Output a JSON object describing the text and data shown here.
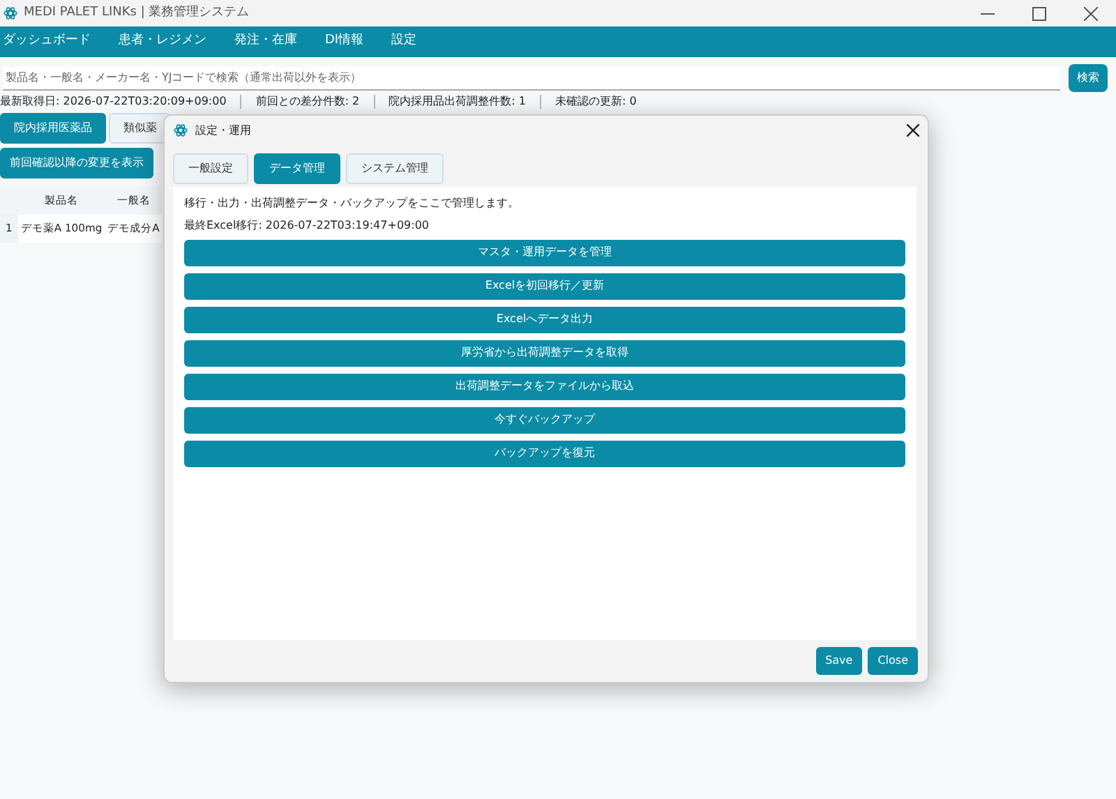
{
  "window": {
    "title": "MEDI PALET LINKs | 業務管理システム"
  },
  "menu": [
    {
      "label": "ダッシュボード"
    },
    {
      "label": "患者・レジメン"
    },
    {
      "label": "発注・在庫"
    },
    {
      "label": "DI情報"
    },
    {
      "label": "設定"
    }
  ],
  "search": {
    "placeholder": "製品名・一般名・メーカー名・YJコードで検索（通常出荷以外を表示）",
    "button": "検索"
  },
  "status": [
    "最新取得日: 2026-07-22T03:20:09+09:00",
    "前回との差分件数: 2",
    "院内採用品出荷調整件数: 1",
    "未確認の更新: 0"
  ],
  "filters": [
    {
      "label": "院内採用医薬品"
    },
    {
      "label": "類似薬"
    }
  ],
  "changes_button": "前回確認以降の変更を表示",
  "table": {
    "columns": [
      "製品名",
      "一般名"
    ],
    "rows": [
      {
        "number": "1",
        "cells": [
          "デモ薬A 100mg",
          "デモ成分A"
        ]
      }
    ]
  },
  "dialog": {
    "title": "設定・運用",
    "tabs": [
      {
        "label": "一般設定",
        "selected": false
      },
      {
        "label": "データ管理",
        "selected": true
      },
      {
        "label": "システム管理",
        "selected": false
      }
    ],
    "description": "移行・出力・出荷調整データ・バックアップをここで管理します。",
    "last_migration": "最終Excel移行: 2026-07-22T03:19:47+09:00",
    "actions": [
      "マスタ・運用データを管理",
      "Excelを初回移行／更新",
      "Excelへデータ出力",
      "厚労省から出荷調整データを取得",
      "出荷調整データをファイルから取込",
      "今すぐバックアップ",
      "バックアップを復元"
    ],
    "buttons": [
      "Save",
      "Close"
    ]
  }
}
